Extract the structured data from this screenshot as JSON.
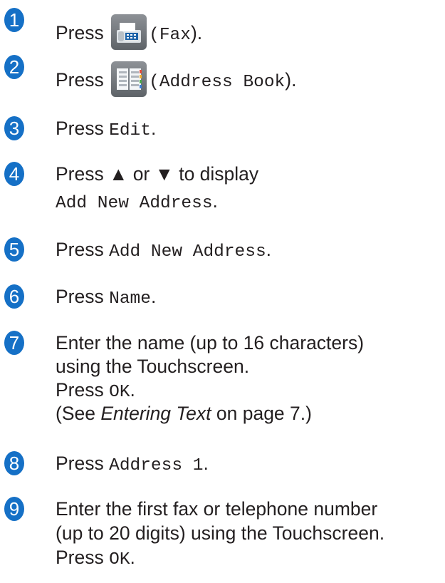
{
  "steps": [
    {
      "number": "1",
      "press": "Press",
      "paren_open": "(",
      "button": "Fax",
      "paren_close": ").",
      "icon": "fax-icon"
    },
    {
      "number": "2",
      "press": "Press",
      "paren_open": "(",
      "button": "Address Book",
      "paren_close": ").",
      "icon": "address-book-icon"
    },
    {
      "number": "3",
      "press": "Press",
      "button": "Edit",
      "end": "."
    },
    {
      "number": "4",
      "line1": "Press ▲ or ▼ to display",
      "button": "Add New Address",
      "end": "."
    },
    {
      "number": "5",
      "press": "Press",
      "button": "Add New Address",
      "end": "."
    },
    {
      "number": "6",
      "press": "Press",
      "button": "Name",
      "end": "."
    },
    {
      "number": "7",
      "line1": "Enter the name (up to 16 characters)",
      "line2": "using the Touchscreen.",
      "press": "Press",
      "button": "OK",
      "end": ".",
      "see_open": "(See ",
      "see_link": "Entering Text",
      "see_rest": " on page 7.)"
    },
    {
      "number": "8",
      "press": "Press",
      "button": "Address 1",
      "end": "."
    },
    {
      "number": "9",
      "line1": "Enter the first fax or telephone number",
      "line2": "(up to 20 digits) using the Touchscreen.",
      "press": "Press",
      "button": "OK",
      "end": "."
    }
  ],
  "colors": {
    "step_badge": "#1570c6",
    "text": "#231f20",
    "icon_gray": "#73787d"
  }
}
